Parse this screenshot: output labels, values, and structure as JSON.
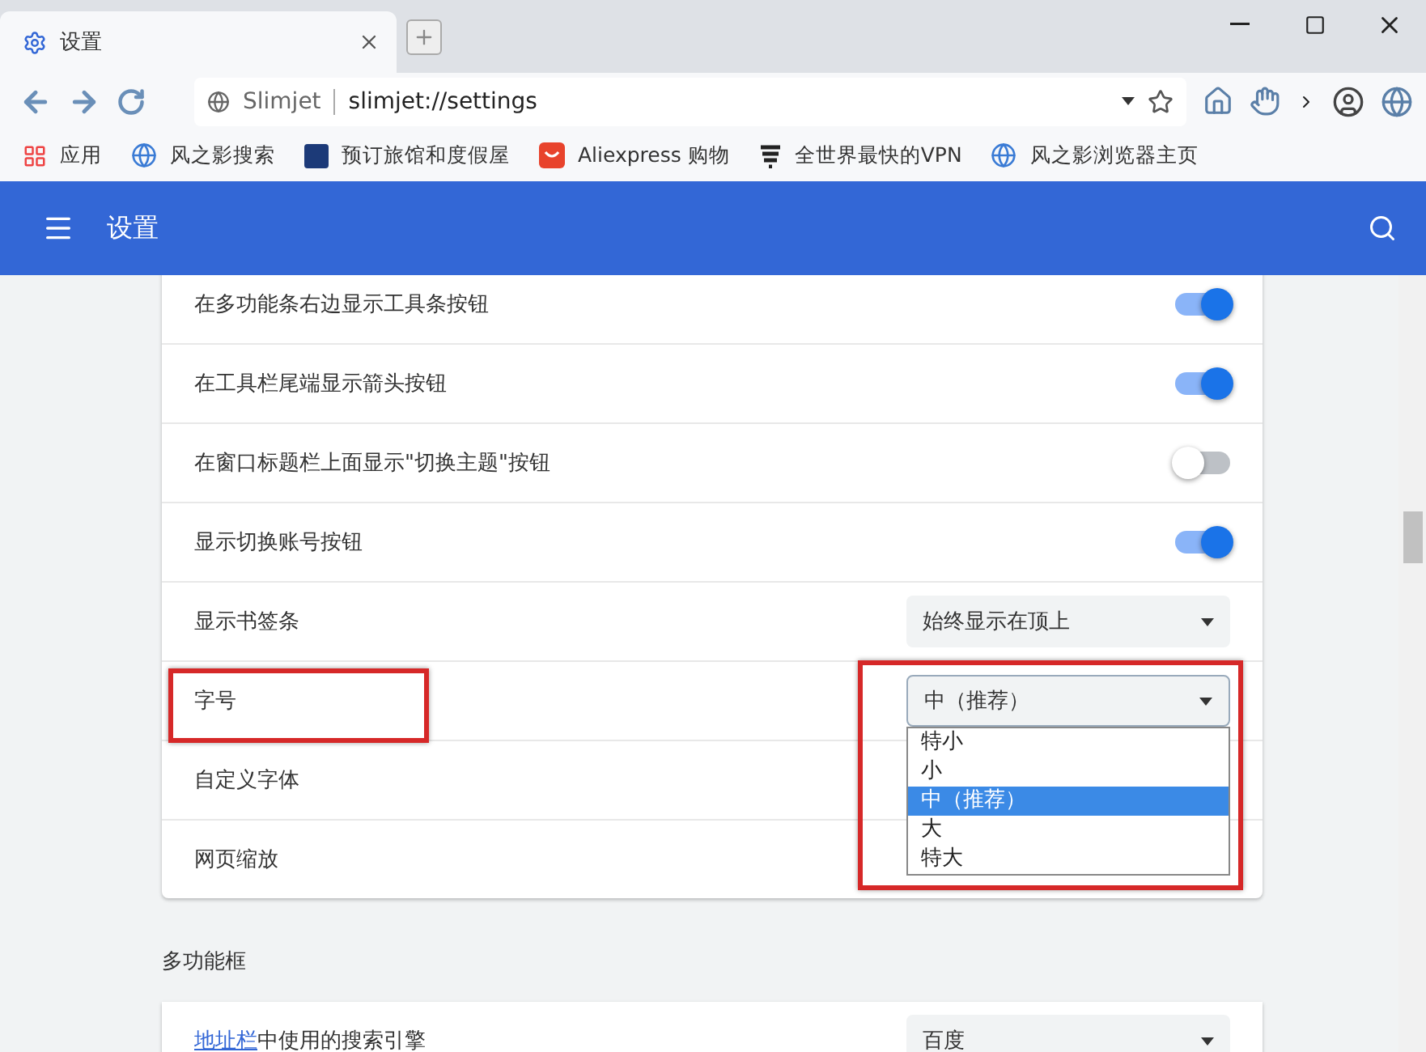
{
  "window": {
    "tab_title": "设置"
  },
  "address_bar": {
    "site": "Slimjet",
    "url": "slimjet://settings"
  },
  "bookmarks": [
    {
      "kind": "apps",
      "label": "应用"
    },
    {
      "kind": "globe",
      "label": "风之影搜索"
    },
    {
      "kind": "booking",
      "label": "预订旅馆和度假屋"
    },
    {
      "kind": "shop",
      "label": "Aliexpress 购物"
    },
    {
      "kind": "vpn",
      "label": "全世界最快的VPN"
    },
    {
      "kind": "globe",
      "label": "风之影浏览器主页"
    }
  ],
  "app_bar": {
    "title": "设置"
  },
  "settings": [
    {
      "kind": "toggle",
      "label": "在多功能条右边显示工具条按钮",
      "on": true
    },
    {
      "kind": "toggle",
      "label": "在工具栏尾端显示箭头按钮",
      "on": true
    },
    {
      "kind": "toggle",
      "label": "在窗口标题栏上面显示\"切换主题\"按钮",
      "on": false
    },
    {
      "kind": "toggle",
      "label": "显示切换账号按钮",
      "on": true
    },
    {
      "kind": "select",
      "label": "显示书签条",
      "value": "始终显示在顶上"
    },
    {
      "kind": "select",
      "label": "字号",
      "value": "中（推荐）",
      "highlighted": true,
      "expanded": true,
      "options": [
        {
          "label": "特小",
          "selected": false
        },
        {
          "label": "小",
          "selected": false
        },
        {
          "label": "中（推荐）",
          "selected": true
        },
        {
          "label": "大",
          "selected": false
        },
        {
          "label": "特大",
          "selected": false
        }
      ]
    },
    {
      "kind": "plain",
      "label": "自定义字体"
    },
    {
      "kind": "plain",
      "label": "网页缩放"
    }
  ],
  "omnibox_section": {
    "title": "多功能框",
    "rows": [
      {
        "kind": "select",
        "link": "地址栏",
        "label": "中使用的搜索引擎",
        "value": "百度"
      }
    ]
  }
}
